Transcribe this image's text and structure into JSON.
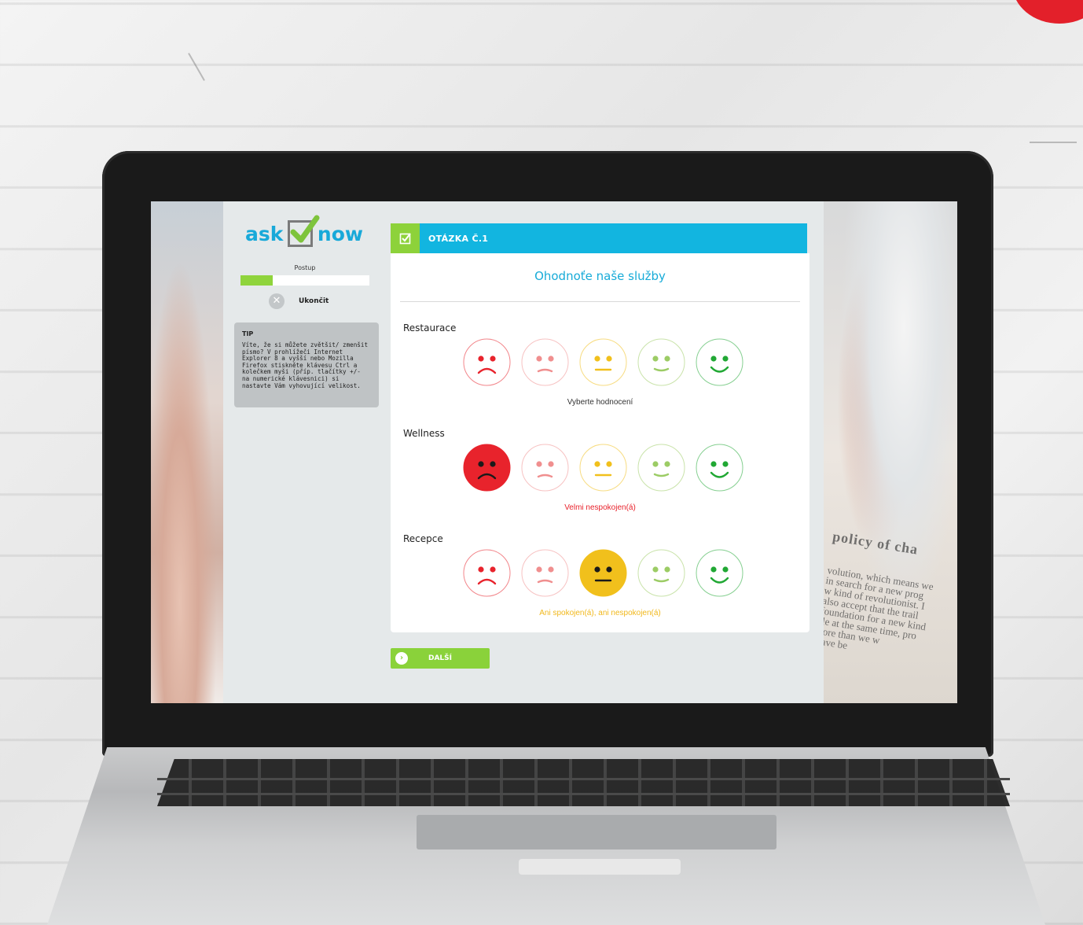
{
  "logo": {
    "left": "ask",
    "right": "now"
  },
  "progress": {
    "label": "Postup",
    "value": 0.25
  },
  "quit": {
    "label": "Ukončit"
  },
  "tip": {
    "title": "TIP",
    "text": "Víte, že si můžete zvětšit/ zmenšit písmo? V prohlížeči Internet Explorer 8 a vyšší nebo Mozilla Firefox stiskněte klávesu Ctrl a kolečkem myši (příp. tlačítky +/- na numerické klávesnici) si nastavte Vám vyhovující velikost."
  },
  "header": {
    "title": "OTÁZKA Č.1"
  },
  "question": {
    "text": "Ohodnoťe naše služby"
  },
  "sections": [
    {
      "label": "Restaurace",
      "selected": -1,
      "status": "Vyberte hodnocení",
      "status_color": "#333333"
    },
    {
      "label": "Wellness",
      "selected": 0,
      "status": "Velmi nespokojen(á)",
      "status_color": "#e8232c"
    },
    {
      "label": "Recepce",
      "selected": 2,
      "status": "Ani spokojen(á), ani nespokojen(á)",
      "status_color": "#f1b81c"
    }
  ],
  "faces": [
    {
      "name": "very-unhappy",
      "color": "#e8232c",
      "mouth": "frown"
    },
    {
      "name": "unhappy",
      "color": "#f08f8f",
      "mouth": "slight-frown"
    },
    {
      "name": "neutral",
      "color": "#f1c01c",
      "mouth": "flat"
    },
    {
      "name": "happy",
      "color": "#9ccc65",
      "mouth": "slight-smile"
    },
    {
      "name": "very-happy",
      "color": "#21a834",
      "mouth": "smile"
    }
  ],
  "next": {
    "label": "DALŠÍ"
  },
  "background_text": {
    "title": "policy of cha",
    "lines": [
      "volution, which means we",
      "in search for a new prog",
      "w kind of revolutionist. I",
      "also accept that the trail",
      "foundation for a new kind",
      "ile at the same time, pro",
      "nore than we w",
      "have be"
    ]
  },
  "colors": {
    "accent_blue": "#12b5e0",
    "accent_green": "#8dd23a",
    "brand_red": "#e3202a"
  }
}
